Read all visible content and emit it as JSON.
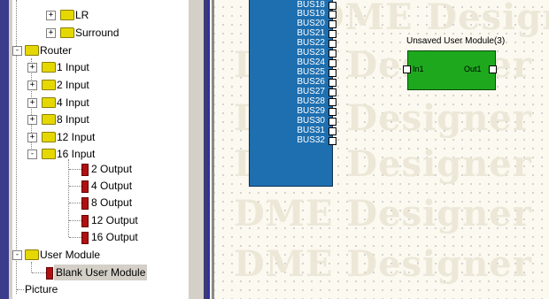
{
  "tree": {
    "items": [
      {
        "label": "LR",
        "type": "folder",
        "expander": "+"
      },
      {
        "label": "Surround",
        "type": "folder",
        "expander": "+"
      },
      {
        "label": "Router",
        "type": "folder",
        "expander": "-"
      },
      {
        "label": "1 Input",
        "type": "folder",
        "expander": "+"
      },
      {
        "label": "2 Input",
        "type": "folder",
        "expander": "+"
      },
      {
        "label": "4 Input",
        "type": "folder",
        "expander": "+"
      },
      {
        "label": "8 Input",
        "type": "folder",
        "expander": "+"
      },
      {
        "label": "12 Input",
        "type": "folder",
        "expander": "+"
      },
      {
        "label": "16 Input",
        "type": "folder",
        "expander": "-"
      },
      {
        "label": "2 Output",
        "type": "module"
      },
      {
        "label": "4 Output",
        "type": "module"
      },
      {
        "label": "8 Output",
        "type": "module"
      },
      {
        "label": "12 Output",
        "type": "module"
      },
      {
        "label": "16 Output",
        "type": "module"
      },
      {
        "label": "User Module",
        "type": "folder",
        "expander": "-"
      },
      {
        "label": "Blank User Module",
        "type": "module",
        "selected": true
      },
      {
        "label": "Picture",
        "type": "leaf"
      }
    ]
  },
  "canvas": {
    "watermark": "DME Designer",
    "bus_labels": [
      "BUS18",
      "BUS19",
      "BUS20",
      "BUS21",
      "BUS22",
      "BUS23",
      "BUS24",
      "BUS25",
      "BUS26",
      "BUS27",
      "BUS28",
      "BUS29",
      "BUS30",
      "BUS31",
      "BUS32"
    ],
    "user_module": {
      "title": "Unsaved User Module(3)",
      "in_label": "In1",
      "out_label": "Out1"
    }
  },
  "colors": {
    "folder": "#e5d800",
    "module_icon": "#b01010",
    "bus_block": "#1e6fb0",
    "user_module": "#1ea81e",
    "selection": "#d4d0c8"
  }
}
